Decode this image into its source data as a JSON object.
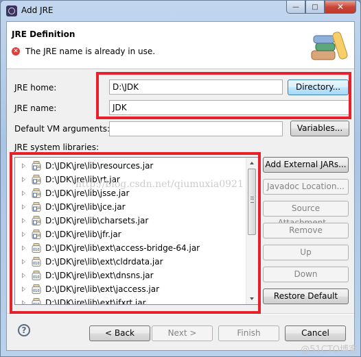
{
  "window": {
    "title": "Add JRE",
    "controls": {
      "minimize": "—",
      "maximize": "□",
      "close": "✕"
    }
  },
  "header": {
    "title": "JRE Definition",
    "message": "The JRE name is already in use.",
    "message_icon": "error-icon",
    "banner_icon": "books-icon"
  },
  "form": {
    "jre_home": {
      "label": "JRE home:",
      "value": "D:\\JDK",
      "button": "Directory..."
    },
    "jre_name": {
      "label": "JRE name:",
      "value": "JDK"
    },
    "vm_args": {
      "label": "Default VM arguments:",
      "value": "",
      "button": "Variables..."
    },
    "libraries_label": "JRE system libraries:"
  },
  "libraries": [
    {
      "path": "D:\\JDK\\jre\\lib\\resources.jar",
      "icon": "jar-source-icon"
    },
    {
      "path": "D:\\JDK\\jre\\lib\\rt.jar",
      "icon": "jar-source-icon"
    },
    {
      "path": "D:\\JDK\\jre\\lib\\jsse.jar",
      "icon": "jar-source-icon"
    },
    {
      "path": "D:\\JDK\\jre\\lib\\jce.jar",
      "icon": "jar-source-icon"
    },
    {
      "path": "D:\\JDK\\jre\\lib\\charsets.jar",
      "icon": "jar-source-icon"
    },
    {
      "path": "D:\\JDK\\jre\\lib\\jfr.jar",
      "icon": "jar-source-icon"
    },
    {
      "path": "D:\\JDK\\jre\\lib\\ext\\access-bridge-64.jar",
      "icon": "jar-binary-icon"
    },
    {
      "path": "D:\\JDK\\jre\\lib\\ext\\cldrdata.jar",
      "icon": "jar-binary-icon"
    },
    {
      "path": "D:\\JDK\\jre\\lib\\ext\\dnsns.jar",
      "icon": "jar-binary-icon"
    },
    {
      "path": "D:\\JDK\\jre\\lib\\ext\\jaccess.jar",
      "icon": "jar-binary-icon"
    },
    {
      "path": "D:\\JDK\\jre\\lib\\ext\\jfxrt.jar",
      "icon": "jar-binary-icon"
    }
  ],
  "library_buttons": {
    "add_external": "Add External JARs...",
    "javadoc": "Javadoc Location...",
    "source": "Source Attachment...",
    "remove": "Remove",
    "up": "Up",
    "down": "Down",
    "restore": "Restore Default"
  },
  "footer": {
    "help": "?",
    "back": "< Back",
    "next": "Next >",
    "finish": "Finish",
    "cancel": "Cancel"
  },
  "watermarks": {
    "center": "http://blog.csdn.net/qiumuxia0921",
    "corner": "@51CTO博客"
  },
  "colors": {
    "highlight_box": "#e8202a",
    "error": "#d9403a",
    "focus_button": "#3c7fb1"
  }
}
